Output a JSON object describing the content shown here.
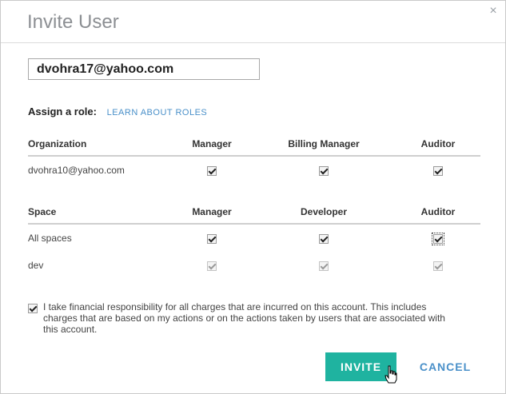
{
  "dialog": {
    "title": "Invite User",
    "close_symbol": "×"
  },
  "email": {
    "value": "dvohra17@yahoo.com"
  },
  "role": {
    "label": "Assign a role:",
    "link": "LEARN ABOUT ROLES"
  },
  "org_table": {
    "headers": [
      "Organization",
      "Manager",
      "Billing Manager",
      "Auditor"
    ],
    "rows": [
      {
        "name": "dvohra10@yahoo.com",
        "checks": [
          true,
          true,
          true
        ]
      }
    ]
  },
  "space_table": {
    "headers": [
      "Space",
      "Manager",
      "Developer",
      "Auditor"
    ],
    "rows": [
      {
        "name": "All spaces",
        "checks": [
          true,
          true,
          true
        ]
      },
      {
        "name": "dev",
        "checks": [
          true,
          true,
          true
        ],
        "disabled": true
      }
    ]
  },
  "agreement": {
    "checked": true,
    "text": "I take financial responsibility for all charges that are incurred on this account. This includes charges that are based on my actions or on the actions taken by users that are associated with this account."
  },
  "buttons": {
    "invite": "INVITE",
    "cancel": "CANCEL"
  },
  "colors": {
    "accent": "#1fb3a0",
    "link": "#4a90c9"
  },
  "icons": {
    "close": "close-icon",
    "cursor": "hand-cursor-icon"
  }
}
